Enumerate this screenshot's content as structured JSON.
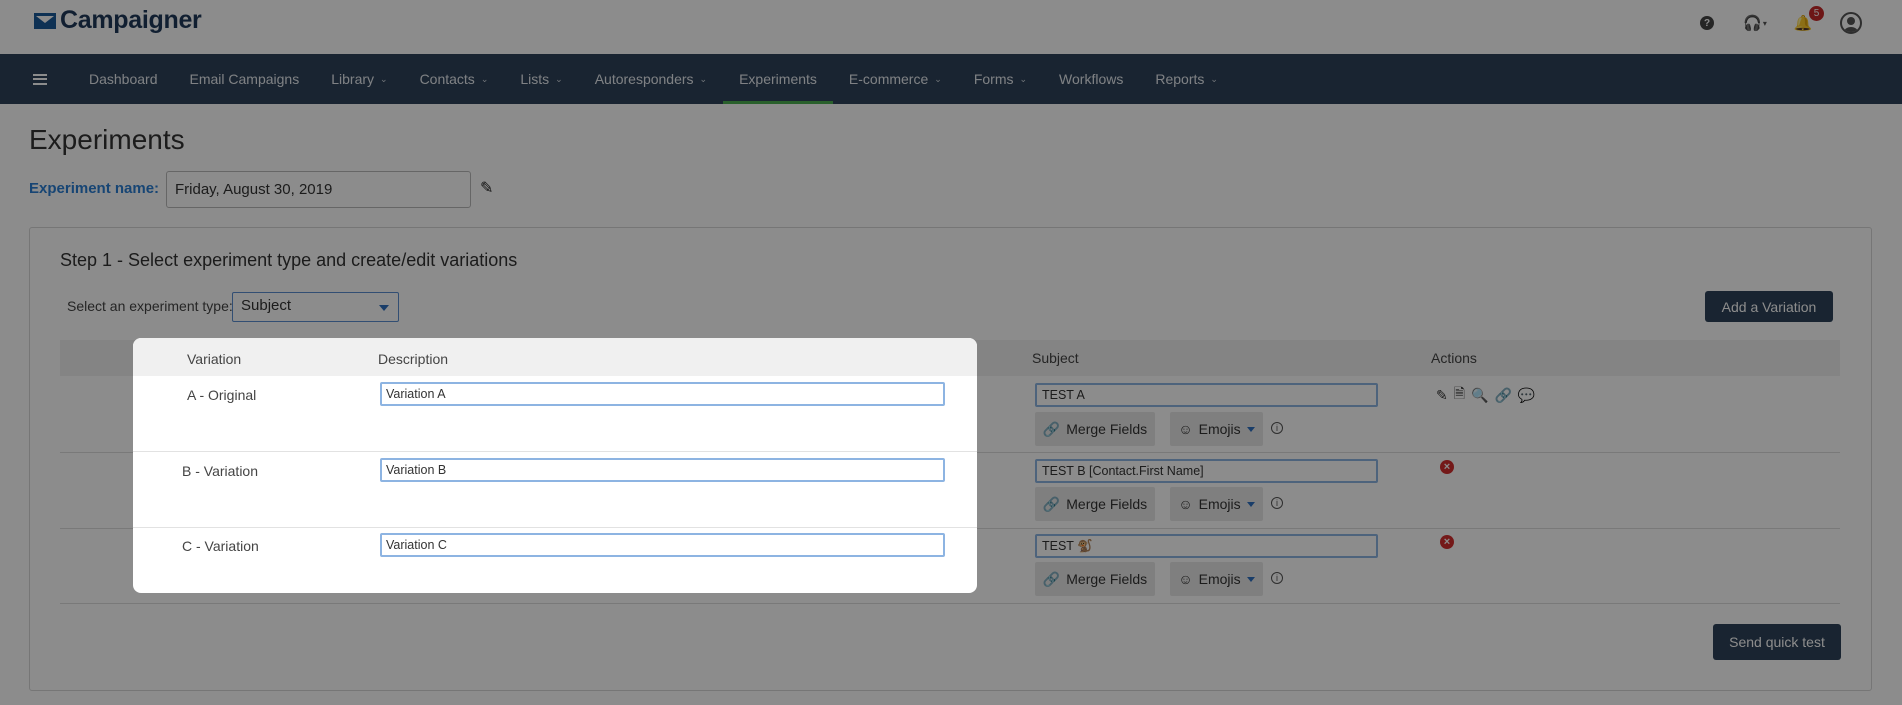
{
  "header": {
    "logo_text": "Campaigner",
    "notification_count": "5",
    "icons": [
      "help-icon",
      "headset-icon",
      "bell-icon",
      "user-icon"
    ]
  },
  "nav": {
    "items": [
      {
        "label": "Dashboard",
        "dropdown": false
      },
      {
        "label": "Email Campaigns",
        "dropdown": false
      },
      {
        "label": "Library",
        "dropdown": true
      },
      {
        "label": "Contacts",
        "dropdown": true
      },
      {
        "label": "Lists",
        "dropdown": true
      },
      {
        "label": "Autoresponders",
        "dropdown": true
      },
      {
        "label": "Experiments",
        "dropdown": false,
        "active": true
      },
      {
        "label": "E-commerce",
        "dropdown": true
      },
      {
        "label": "Forms",
        "dropdown": true
      },
      {
        "label": "Workflows",
        "dropdown": false
      },
      {
        "label": "Reports",
        "dropdown": true
      }
    ]
  },
  "page": {
    "title": "Experiments",
    "experiment_name_label": "Experiment name:",
    "experiment_name_value": "Friday, August 30, 2019"
  },
  "step1": {
    "title": "Step 1 - Select experiment type and create/edit variations",
    "type_label": "Select an experiment type:",
    "type_value": "Subject",
    "add_variation_label": "Add a Variation",
    "send_quick_test_label": "Send quick test",
    "columns": {
      "variation": "Variation",
      "description": "Description",
      "subject": "Subject",
      "actions": "Actions"
    },
    "merge_fields_label": "Merge Fields",
    "emojis_label": "Emojis",
    "rows": [
      {
        "variation": "A - Original",
        "description": "Variation A",
        "subject": "TEST A"
      },
      {
        "variation": "B - Variation",
        "description": "Variation B",
        "subject": "TEST B [Contact.First Name]"
      },
      {
        "variation": "C - Variation",
        "description": "Variation C",
        "subject": "TEST 🐒"
      }
    ]
  },
  "colors": {
    "nav_bg": "#2f4359",
    "accent_blue": "#2a7fd4",
    "active_underline": "#4caf50",
    "delete_red": "#d32f2f",
    "badge_red": "#c62828"
  }
}
